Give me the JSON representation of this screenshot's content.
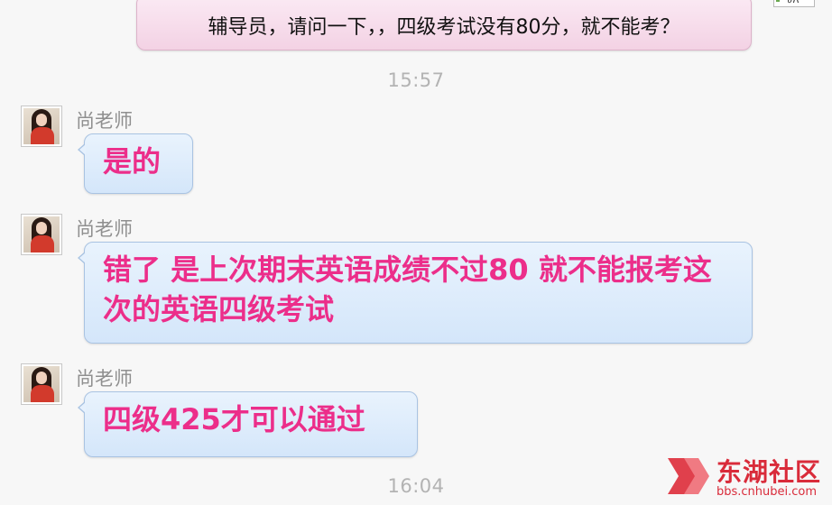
{
  "outgoing": {
    "text": "辅导员，请问一下，，四级考试没有80分，就不能考？"
  },
  "timestamps": [
    "15:57",
    "16:04"
  ],
  "messages": [
    {
      "sender": "尚老师",
      "text": "是的"
    },
    {
      "sender": "尚老师",
      "text": "错了 是上次期末英语成绩不过80 就不能报考这次的英语四级考试"
    },
    {
      "sender": "尚老师",
      "text": "四级425才可以通过"
    }
  ],
  "watermark": {
    "name": "东湖社区",
    "url": "bbs.cnhubei.com"
  },
  "colors": {
    "incoming_text": "#ec2e8a",
    "incoming_bubble": "#dbeafb",
    "outgoing_bubble": "#f6dcea",
    "watermark": "#d92b3a"
  }
}
